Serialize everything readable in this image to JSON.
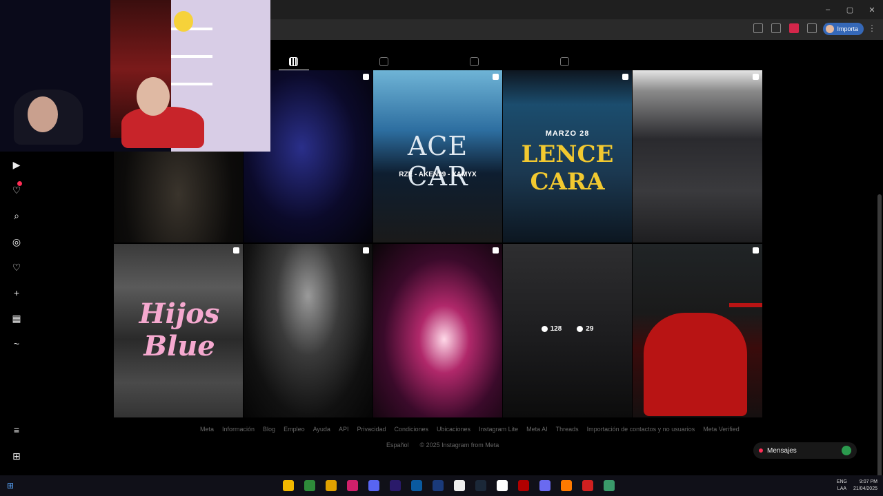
{
  "browser": {
    "window_controls": [
      "–",
      "▢",
      "✕"
    ],
    "profile_label": "Importa",
    "menu_glyph": "⋮"
  },
  "sidebar": {
    "items": [
      {
        "icon": "reels-icon",
        "glyph": "▶"
      },
      {
        "icon": "activity-icon",
        "glyph": "♡",
        "badge": true
      },
      {
        "icon": "search-icon",
        "glyph": "⌕"
      },
      {
        "icon": "explore-icon",
        "glyph": "◎"
      },
      {
        "icon": "heart-icon",
        "glyph": "♡"
      },
      {
        "icon": "create-icon",
        "glyph": "+"
      },
      {
        "icon": "dashboard-icon",
        "glyph": "▦"
      },
      {
        "icon": "threads-icon",
        "glyph": "~"
      },
      {
        "icon": "menu-icon",
        "glyph": "≡"
      },
      {
        "icon": "meta-icon",
        "glyph": "⊞"
      }
    ]
  },
  "profile_tabs": [
    {
      "name": "tab-posts",
      "icon": "grid-icon",
      "active": true
    },
    {
      "name": "tab-reels",
      "icon": "reels-icon",
      "active": false
    },
    {
      "name": "tab-reposts",
      "icon": "repost-icon",
      "active": false
    },
    {
      "name": "tab-tagged",
      "icon": "tagged-icon",
      "active": false
    }
  ],
  "posts": {
    "p3": {
      "title": "ACE CAR",
      "credits": "RZE - AKEN99 - XAMYX"
    },
    "p4": {
      "date": "MARZO 28",
      "title": "LENCE CARA"
    },
    "p6": {
      "title": "Hijos Blue"
    },
    "p9": {
      "likes": "128",
      "comments": "29"
    }
  },
  "footer": {
    "links": [
      "Meta",
      "Información",
      "Blog",
      "Empleo",
      "Ayuda",
      "API",
      "Privacidad",
      "Condiciones",
      "Ubicaciones",
      "Instagram Lite",
      "Meta AI",
      "Threads",
      "Importación de contactos y no usuarios",
      "Meta Verified"
    ],
    "language": "Español",
    "copyright": "© 2025 Instagram from Meta"
  },
  "messages": {
    "label": "Mensajes"
  },
  "taskbar": {
    "lang_line1": "ENG",
    "lang_line2": "LAA",
    "time": "9:07 PM",
    "date": "21/04/2025"
  },
  "colors": {
    "accent": "#ff2d55",
    "profile_chip": "#3568b8",
    "poster_gold": "#f2c930",
    "script_pink": "#f5a9cf"
  }
}
